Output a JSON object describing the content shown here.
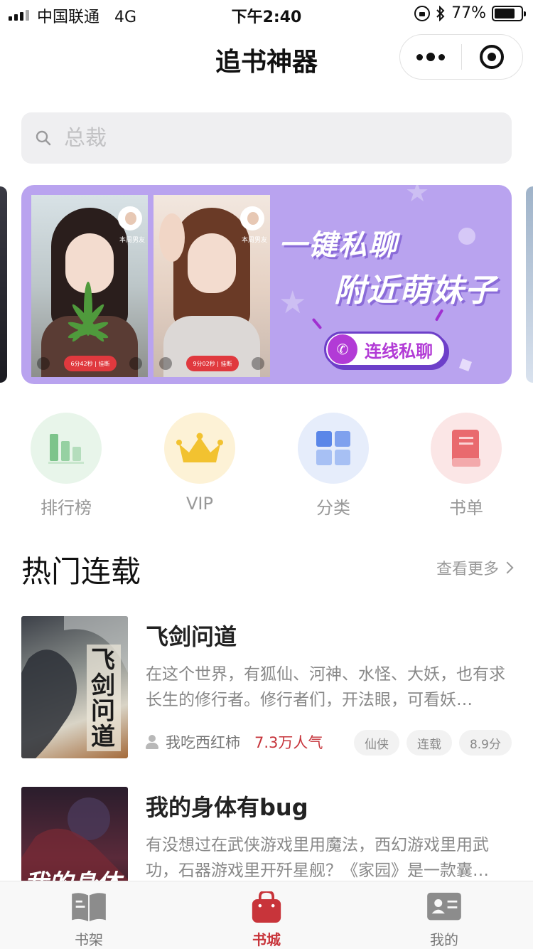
{
  "status_bar": {
    "carrier": "中国联通",
    "network": "4G",
    "time": "下午2:40",
    "battery": "77%",
    "battery_level": 0.77
  },
  "nav": {
    "title": "追书神器"
  },
  "search": {
    "placeholder": "总裁"
  },
  "banner": {
    "headline_line1": "一键私聊",
    "headline_line2": "附近萌妹子",
    "cta": "连线私聊",
    "cards": [
      {
        "tag": "本周男友",
        "timer": "6分42秒",
        "hangup": "挂断"
      },
      {
        "tag": "本周男友",
        "timer": "9分02秒",
        "hangup": "挂断"
      }
    ]
  },
  "entries": [
    {
      "label": "排行榜",
      "icon": "ranking-bars-icon",
      "color": "#7dc48b",
      "bg": "#e8f5ea"
    },
    {
      "label": "VIP",
      "icon": "crown-icon",
      "color": "#f2c230",
      "bg": "#fdf2d6"
    },
    {
      "label": "分类",
      "icon": "category-grid-icon",
      "color": "#5a86e8",
      "bg": "#e6edfb"
    },
    {
      "label": "书单",
      "icon": "book-list-icon",
      "color": "#e96a6e",
      "bg": "#fbe6e6"
    }
  ],
  "section": {
    "title": "热门连载",
    "more": "查看更多"
  },
  "books": [
    {
      "title": "飞剑问道",
      "desc": "在这个世界，有狐仙、河神、水怪、大妖，也有求长生的修行者。修行者们，开法眼，可看妖…",
      "author": "我吃西红柿",
      "popularity": "7.3万人气",
      "tags": [
        "仙侠",
        "连载",
        "8.9分"
      ],
      "cover_text": "飞剑问道"
    },
    {
      "title": "我的身体有bug",
      "desc": "有没想过在武侠游戏里用魔法，西幻游戏里用武功，石器游戏里开歼星舰？《家园》是一款囊…",
      "cover_text": "我的身体"
    }
  ],
  "tabbar": {
    "items": [
      {
        "label": "书架",
        "icon": "bookshelf-icon",
        "active": false
      },
      {
        "label": "书城",
        "icon": "bookstore-bag-icon",
        "active": true
      },
      {
        "label": "我的",
        "icon": "profile-card-icon",
        "active": false
      }
    ]
  },
  "colors": {
    "accent": "#c8343a",
    "banner_bg": "#b9a3ef",
    "search_bg": "#efeff1"
  }
}
